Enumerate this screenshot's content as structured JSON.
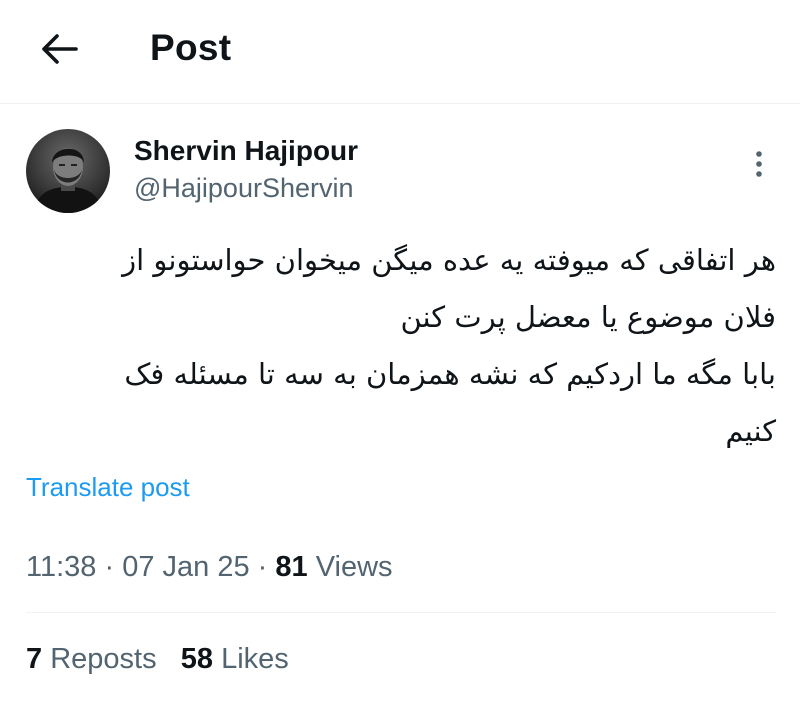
{
  "header": {
    "back_icon": "arrow-left-icon",
    "title": "Post"
  },
  "author": {
    "name": "Shervin Hajipour",
    "handle": "@HajipourShervin",
    "more_icon": "more-vertical-icon"
  },
  "post": {
    "text": "هر اتفاقی که میوفته یه عده میگن میخوان حواستونو از\nفلان موضوع یا معضل پرت کنن\nبابا مگه ما اردکیم که نشه همزمان به سه تا مسئله فک\nکنیم",
    "translate_label": "Translate post"
  },
  "meta": {
    "time": "11:38",
    "sep1": " · ",
    "date": "07 Jan 25",
    "sep2": " · ",
    "views_count": "81",
    "views_label": " Views"
  },
  "stats": {
    "reposts_count": "7",
    "reposts_label": " Reposts",
    "likes_count": "58",
    "likes_label": " Likes"
  },
  "colors": {
    "text": "#0f1419",
    "secondary": "#536471",
    "link": "#1d9bf0",
    "divider": "#eff3f4"
  }
}
